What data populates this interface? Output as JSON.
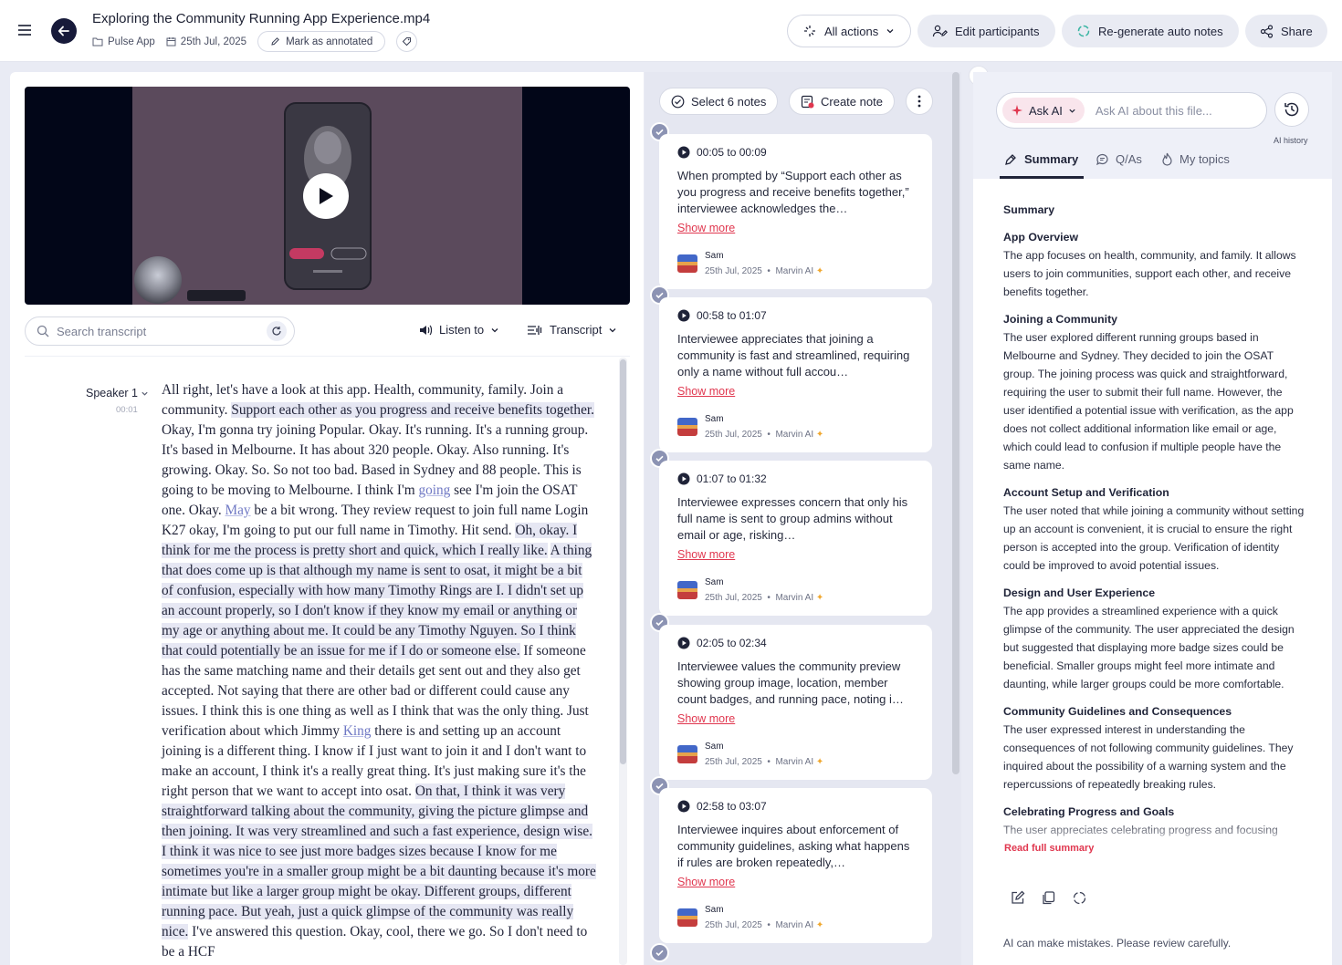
{
  "header": {
    "file_title": "Exploring the Community Running App Experience.mp4",
    "project": "Pulse App",
    "date": "25th Jul, 2025",
    "mark_annotated": "Mark as annotated",
    "all_actions": "All actions",
    "edit_participants": "Edit participants",
    "regenerate": "Re-generate auto notes",
    "share": "Share"
  },
  "player": {
    "search_placeholder": "Search transcript",
    "listen_to": "Listen to",
    "transcript_label": "Transcript"
  },
  "transcript": {
    "speaker": "Speaker 1",
    "time": "00:01",
    "segments": [
      {
        "t": "All right, let's have a look at this app. Health, community, family. Join a community. ",
        "k": "n"
      },
      {
        "t": "Support each other as you progress and receive benefits together.",
        "k": "h"
      },
      {
        "t": " Okay, I'm gonna try joining Popular. Okay. It's running. It's a running group. It's based in Melbourne. It has about 320 people. Okay. Also running. It's growing. Okay. So. So not too bad. Based in Sydney and 88 people. This is going to be moving to Melbourne. I think I'm ",
        "k": "n"
      },
      {
        "t": "going",
        "k": "l"
      },
      {
        "t": " see I'm join the OSAT one. Okay. ",
        "k": "n"
      },
      {
        "t": "May",
        "k": "l"
      },
      {
        "t": " be a bit wrong. They review request to join full name Login K27 okay, I'm going to put our full name in Timothy. Hit send. ",
        "k": "n"
      },
      {
        "t": "Oh, okay. I think for me the process is pretty short and quick, which I really like.",
        "k": "h"
      },
      {
        "t": " ",
        "k": "n"
      },
      {
        "t": "A thing that does come up is that although my name is sent to osat, it might be a bit of confusion, especially with how many Timothy Rings are I. I didn't set up an account properly, so I don't know if they know my email or anything or my age or anything about me. It could be any Timothy Nguyen. So I think that could potentially be an issue for me if I do or someone else.",
        "k": "h"
      },
      {
        "t": " If someone has the same matching name and their details get sent out and they also get accepted. Not saying that there are other bad or different could cause any issues. I think this is one thing as well as I think that was the only thing. Just verification about which Jimmy ",
        "k": "n"
      },
      {
        "t": "King",
        "k": "l"
      },
      {
        "t": " there is and setting up an account joining is a different thing. I know if I just want to join it and I don't want to make an account, I think it's a really great thing. It's just making sure it's the right person that we want to accept into osat. ",
        "k": "n"
      },
      {
        "t": "On that, I think it was very straightforward talking about the community, giving the picture glimpse and then joining. It was very streamlined and such a fast experience, design wise. I think it was nice to see just more badges sizes because I know for me sometimes you're in a smaller group might be a bit daunting because it's more intimate but like a larger group might be okay. Different groups, different running pace. But yeah, just a quick glimpse of the community was really nice.",
        "k": "h"
      },
      {
        "t": " I've answered this question. Okay, cool, there we go. So I don't need to be a HCF",
        "k": "n"
      }
    ]
  },
  "notes_toolbar": {
    "select": "Select 6 notes",
    "create": "Create note"
  },
  "notes": [
    {
      "time": "00:05 to 00:09",
      "text": "When prompted by “Support each other as you progress and receive benefits together,” interviewee acknowledges the…",
      "more": "Show more",
      "author": "Sam",
      "date": "25th Jul, 2025",
      "source": "Marvin AI"
    },
    {
      "time": "00:58 to 01:07",
      "text": "Interviewee appreciates that joining a community is fast and streamlined, requiring only a name without full accou…",
      "more": "Show more",
      "author": "Sam",
      "date": "25th Jul, 2025",
      "source": "Marvin AI"
    },
    {
      "time": "01:07 to 01:32",
      "text": "Interviewee expresses concern that only his full name is sent to group admins without email or age, risking…",
      "more": "Show more",
      "author": "Sam",
      "date": "25th Jul, 2025",
      "source": "Marvin AI"
    },
    {
      "time": "02:05 to 02:34",
      "text": "Interviewee values the community preview showing group image, location, member count badges, and running pace, noting i…",
      "more": "Show more",
      "author": "Sam",
      "date": "25th Jul, 2025",
      "source": "Marvin AI"
    },
    {
      "time": "02:58 to 03:07",
      "text": "Interviewee inquires about enforcement of community guidelines, asking what happens if rules are broken repeatedly,…",
      "more": "Show more",
      "author": "Sam",
      "date": "25th Jul, 2025",
      "source": "Marvin AI"
    }
  ],
  "ai": {
    "ask_label": "Ask AI",
    "placeholder": "Ask AI about this file...",
    "history": "AI history",
    "tabs": [
      "Summary",
      "Q/As",
      "My topics"
    ],
    "summary_title": "Summary",
    "sections": [
      {
        "h": "App Overview",
        "p": "The app focuses on health, community, and family. It allows users to join communities, support each other, and receive benefits together."
      },
      {
        "h": "Joining a Community",
        "p": "The user explored different running groups based in Melbourne and Sydney. They decided to join the OSAT group. The joining process was quick and straightforward, requiring the user to submit their full name. However, the user identified a potential issue with verification, as the app does not collect additional information like email or age, which could lead to confusion if multiple people have the same name."
      },
      {
        "h": "Account Setup and Verification",
        "p": "The user noted that while joining a community without setting up an account is convenient, it is crucial to ensure the right person is accepted into the group. Verification of identity could be improved to avoid potential issues."
      },
      {
        "h": "Design and User Experience",
        "p": "The app provides a streamlined experience with a quick glimpse of the community. The user appreciated the design but suggested that displaying more badge sizes could be beneficial. Smaller groups might feel more intimate and daunting, while larger groups could be more comfortable."
      },
      {
        "h": "Community Guidelines and Consequences",
        "p": "The user expressed interest in understanding the consequences of not following community guidelines. They inquired about the possibility of a warning system and the repercussions of repeatedly breaking rules."
      },
      {
        "h": "Celebrating Progress and Goals",
        "p": "The user appreciates celebrating progress and focusing"
      }
    ],
    "read_full": "Read full summary",
    "disclaimer": "AI can make mistakes. Please review carefully."
  }
}
